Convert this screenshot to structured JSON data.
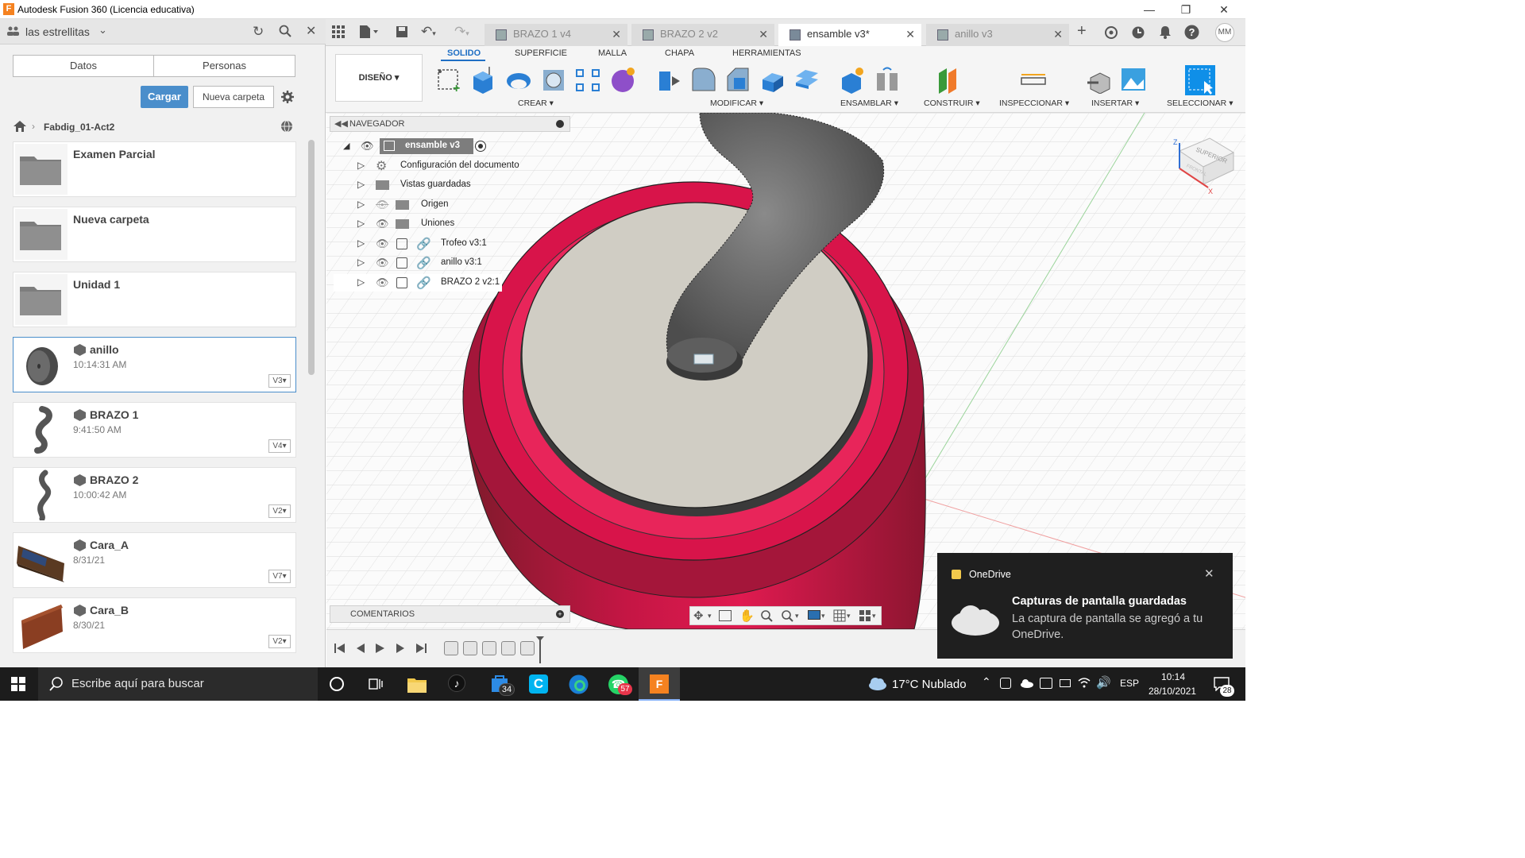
{
  "window": {
    "title": "Autodesk Fusion 360 (Licencia educativa)",
    "logo_letter": "F"
  },
  "left_panel": {
    "team_name": "las estrellitas",
    "tabs": [
      "Datos",
      "Personas"
    ],
    "upload_label": "Cargar",
    "new_folder_label": "Nueva carpeta",
    "breadcrumb": "Fabdig_01-Act2",
    "items": [
      {
        "name": "Examen Parcial",
        "kind": "folder",
        "time": "",
        "version": ""
      },
      {
        "name": "Nueva carpeta",
        "kind": "folder",
        "time": "",
        "version": ""
      },
      {
        "name": "Unidad 1",
        "kind": "folder",
        "time": "",
        "version": ""
      },
      {
        "name": "anillo",
        "kind": "design",
        "time": "10:14:31 AM",
        "version": "V3"
      },
      {
        "name": "BRAZO 1",
        "kind": "design",
        "time": "9:41:50 AM",
        "version": "V4"
      },
      {
        "name": "BRAZO 2",
        "kind": "design",
        "time": "10:00:42 AM",
        "version": "V2"
      },
      {
        "name": "Cara_A",
        "kind": "design",
        "time": "8/31/21",
        "version": "V7"
      },
      {
        "name": "Cara_B",
        "kind": "design",
        "time": "8/30/21",
        "version": "V2"
      }
    ]
  },
  "doc_tabs": [
    {
      "label": "BRAZO 1 v4",
      "active": false
    },
    {
      "label": "BRAZO 2 v2",
      "active": false
    },
    {
      "label": "ensamble v3*",
      "active": true
    },
    {
      "label": "anillo v3",
      "active": false
    }
  ],
  "user_initials": "MM",
  "ribbon": {
    "workspace": "DISEÑO",
    "tabs": [
      "SOLIDO",
      "SUPERFICIE",
      "MALLA",
      "CHAPA",
      "HERRAMIENTAS"
    ],
    "groups": [
      "CREAR",
      "MODIFICAR",
      "ENSAMBLAR",
      "CONSTRUIR",
      "INSPECCIONAR",
      "INSERTAR",
      "SELECCIONAR"
    ]
  },
  "navigator": {
    "title": "NAVEGADOR",
    "root": "ensamble v3",
    "rows": [
      {
        "label": "Configuración del documento"
      },
      {
        "label": "Vistas guardadas"
      },
      {
        "label": "Origen"
      },
      {
        "label": "Uniones"
      },
      {
        "label": "Trofeo v3:1"
      },
      {
        "label": "anillo v3:1"
      },
      {
        "label": "BRAZO 2 v2:1"
      }
    ]
  },
  "viewcube": {
    "face_top": "SUPERIOR",
    "face_front": "FRONTAL",
    "axis_z": "Z",
    "axis_x": "X"
  },
  "comments_label": "COMENTARIOS",
  "notification": {
    "app": "OneDrive",
    "title": "Capturas de pantalla guardadas",
    "body": "La captura de pantalla se agregó a tu OneDrive."
  },
  "taskbar": {
    "search_placeholder": "Escribe aquí para buscar",
    "weather": "17°C  Nublado",
    "language": "ESP",
    "time": "10:14",
    "date": "28/10/2021",
    "badge_store": "34",
    "badge_whatsapp": "57",
    "badge_notifications": "28"
  },
  "colors": {
    "accent": "#4a8ecb",
    "ribbon_active": "#1f6fc4",
    "trophy_red": "#d8144a",
    "trophy_base": "#d0cdc4",
    "arm_gray": "#5e5e5e"
  }
}
